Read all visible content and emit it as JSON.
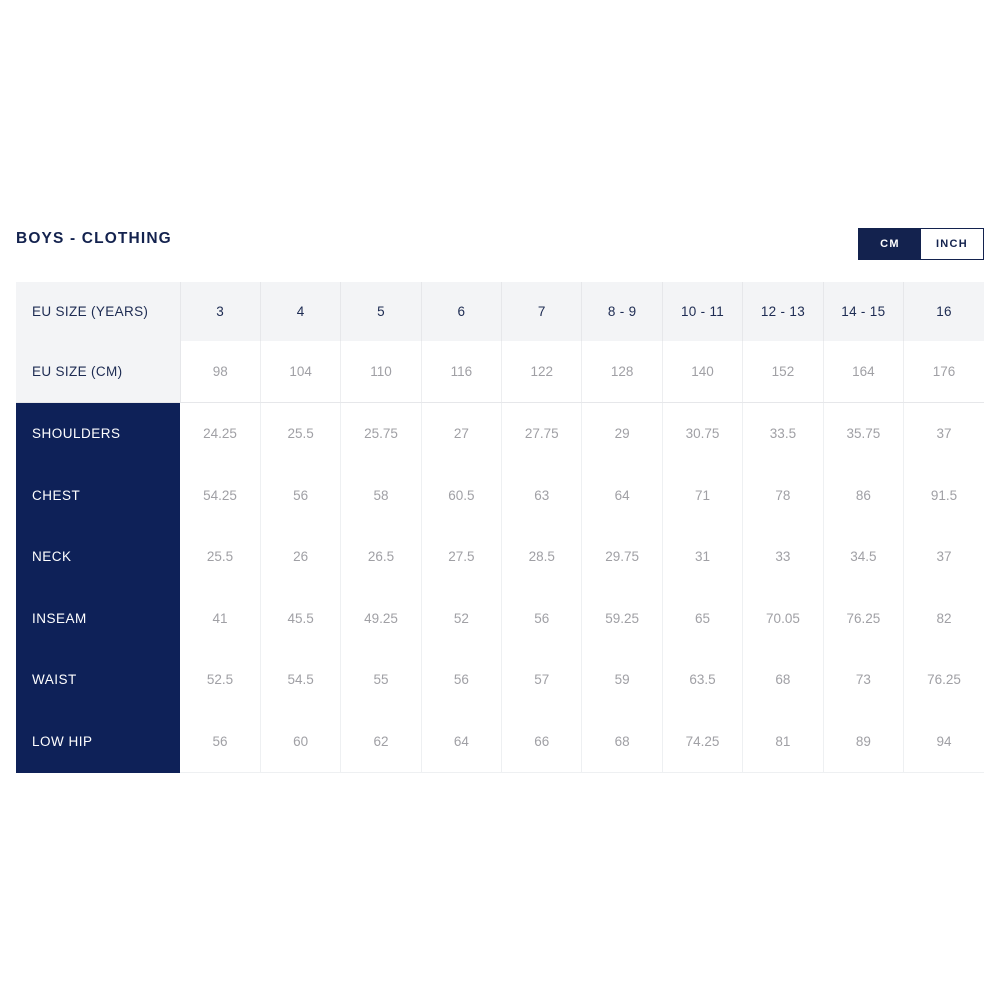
{
  "header": {
    "title": "BOYS - CLOTHING"
  },
  "unit_toggle": {
    "active": "cm",
    "options": [
      {
        "id": "cm",
        "label": "CM",
        "active": true
      },
      {
        "id": "inch",
        "label": "INCH",
        "active": false
      }
    ]
  },
  "colors": {
    "navy": "#0e2158",
    "title_navy": "#13224e",
    "header_bg": "#f3f4f6",
    "data_text": "#a0a0a5",
    "border": "#e6e7ea"
  },
  "chart_data": {
    "type": "table",
    "title": "BOYS - CLOTHING",
    "unit": "CM",
    "row_header_labels": [
      "EU SIZE (YEARS)",
      "EU SIZE (CM)"
    ],
    "columns": {
      "eu_size_years": [
        "3",
        "4",
        "5",
        "6",
        "7",
        "8 - 9",
        "10 - 11",
        "12 - 13",
        "14 - 15",
        "16"
      ],
      "eu_size_cm": [
        "98",
        "104",
        "110",
        "116",
        "122",
        "128",
        "140",
        "152",
        "164",
        "176"
      ]
    },
    "measurements": [
      {
        "label": "SHOULDERS",
        "values": [
          "24.25",
          "25.5",
          "25.75",
          "27",
          "27.75",
          "29",
          "30.75",
          "33.5",
          "35.75",
          "37"
        ]
      },
      {
        "label": "CHEST",
        "values": [
          "54.25",
          "56",
          "58",
          "60.5",
          "63",
          "64",
          "71",
          "78",
          "86",
          "91.5"
        ]
      },
      {
        "label": "NECK",
        "values": [
          "25.5",
          "26",
          "26.5",
          "27.5",
          "28.5",
          "29.75",
          "31",
          "33",
          "34.5",
          "37"
        ]
      },
      {
        "label": "INSEAM",
        "values": [
          "41",
          "45.5",
          "49.25",
          "52",
          "56",
          "59.25",
          "65",
          "70.05",
          "76.25",
          "82"
        ]
      },
      {
        "label": "WAIST",
        "values": [
          "52.5",
          "54.5",
          "55",
          "56",
          "57",
          "59",
          "63.5",
          "68",
          "73",
          "76.25"
        ]
      },
      {
        "label": "LOW HIP",
        "values": [
          "56",
          "60",
          "62",
          "64",
          "66",
          "68",
          "74.25",
          "81",
          "89",
          "94"
        ]
      }
    ]
  }
}
